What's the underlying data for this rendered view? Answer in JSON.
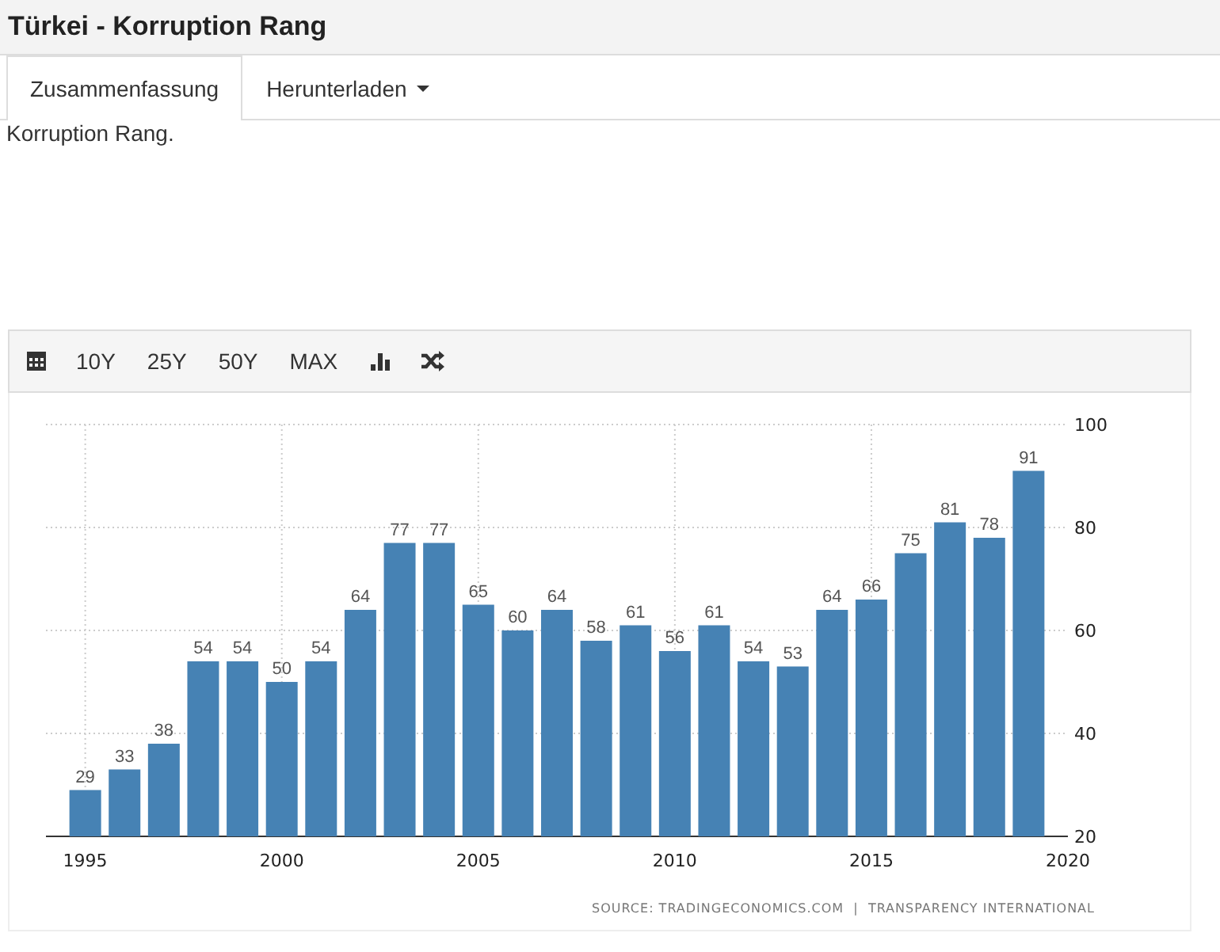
{
  "page_title": "Türkei - Korruption Rang",
  "tabs": [
    {
      "label": "Zusammenfassung",
      "selected": true
    },
    {
      "label": "Herunterladen",
      "selected": false,
      "dropdown": true
    }
  ],
  "description": "Korruption Rang.",
  "toolbar": {
    "ranges": [
      "10Y",
      "25Y",
      "50Y",
      "MAX"
    ]
  },
  "chart": {
    "chart_data": {
      "type": "bar",
      "x": [
        1995,
        1996,
        1997,
        1998,
        1999,
        2000,
        2001,
        2002,
        2003,
        2004,
        2005,
        2006,
        2007,
        2008,
        2009,
        2010,
        2011,
        2012,
        2013,
        2014,
        2015,
        2016,
        2017,
        2018,
        2019
      ],
      "values": [
        29,
        33,
        38,
        54,
        54,
        50,
        54,
        64,
        77,
        77,
        65,
        60,
        64,
        58,
        61,
        56,
        61,
        54,
        53,
        64,
        66,
        75,
        81,
        78,
        91
      ],
      "xlim": [
        1994,
        2020
      ],
      "ylim": [
        20,
        100
      ],
      "grid": true,
      "xticks": [
        1995,
        2000,
        2005,
        2010,
        2015,
        2020
      ],
      "yticks": [
        20,
        40,
        60,
        80,
        100
      ],
      "data_labels": true
    },
    "source": "SOURCE: TRADINGECONOMICS.COM  |  TRANSPARENCY INTERNATIONAL"
  }
}
